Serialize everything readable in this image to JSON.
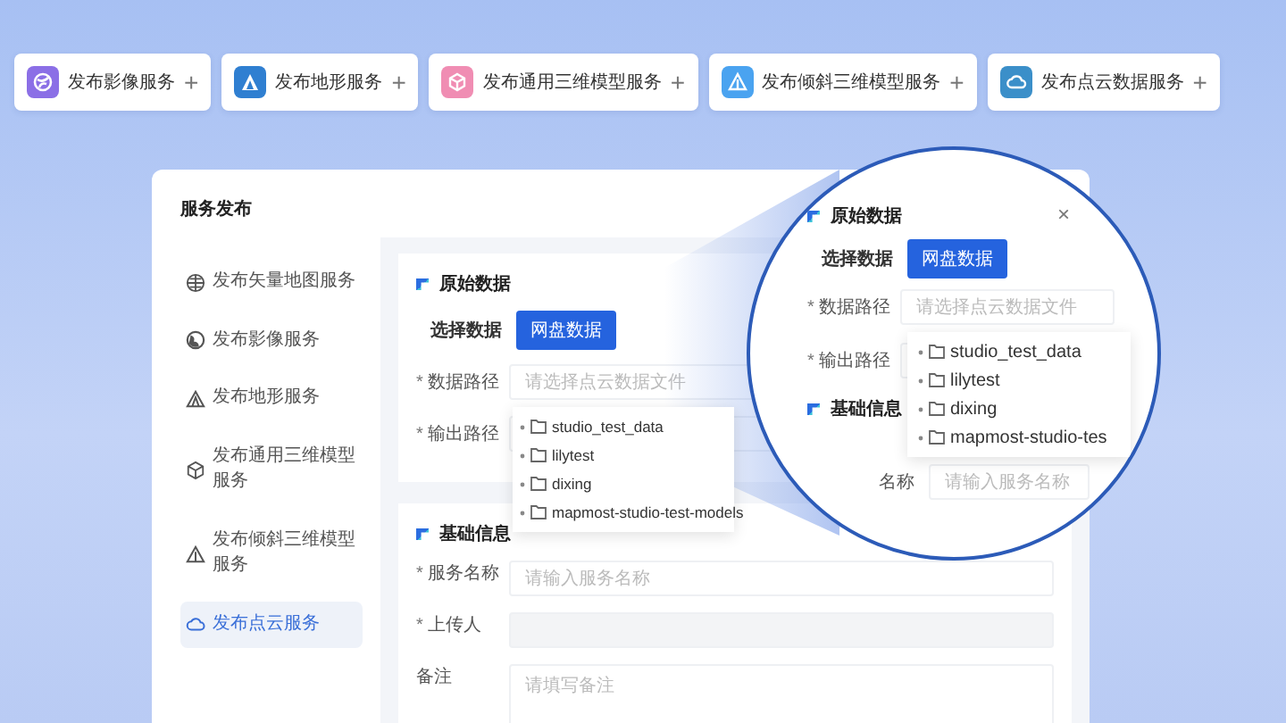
{
  "service_cards": [
    {
      "label": "发布影像服务",
      "plus": "+",
      "kind": "globe",
      "color": "#8b6fe6"
    },
    {
      "label": "发布地形服务",
      "plus": "+",
      "kind": "terrain",
      "color": "#2f7fd1"
    },
    {
      "label": "发布通用三维模型服务",
      "plus": "+",
      "kind": "cube",
      "color": "#f08db3"
    },
    {
      "label": "发布倾斜三维模型服务",
      "plus": "+",
      "kind": "tilt",
      "color": "#4aa3f0"
    },
    {
      "label": "发布点云数据服务",
      "plus": "+",
      "kind": "cloud",
      "color": "#3b8fc9"
    }
  ],
  "dialog": {
    "title": "服务发布"
  },
  "sidebar": {
    "items": [
      {
        "label": "发布矢量地图服务",
        "kind": "globe",
        "selected": false
      },
      {
        "label": "发布影像服务",
        "kind": "earth",
        "selected": false
      },
      {
        "label": "发布地形服务",
        "kind": "terrain",
        "selected": false
      },
      {
        "label": "发布通用三维模型服务",
        "kind": "cube",
        "selected": false
      },
      {
        "label": "发布倾斜三维模型服务",
        "kind": "tilt",
        "selected": false
      },
      {
        "label": "发布点云服务",
        "kind": "cloud",
        "selected": true
      }
    ]
  },
  "source_section": {
    "title": "原始数据",
    "tabs": [
      {
        "label": "选择数据",
        "selected": false
      },
      {
        "label": "网盘数据",
        "selected": true
      }
    ],
    "fields": [
      {
        "mark": "*",
        "label": "数据路径",
        "placeholder": "请选择点云数据文件"
      },
      {
        "mark": "*",
        "label": "输出路径"
      }
    ],
    "tree": [
      {
        "name": "studio_test_data"
      },
      {
        "name": "lilytest"
      },
      {
        "name": "dixing"
      },
      {
        "name": "mapmost-studio-test-models"
      }
    ]
  },
  "basic_section": {
    "title": "基础信息",
    "fields": [
      {
        "mark": "*",
        "label": "服务名称",
        "placeholder": "请输入服务名称",
        "kind": "input"
      },
      {
        "mark": "*",
        "label": "上传人",
        "kind": "readonly"
      },
      {
        "label": "备注",
        "placeholder": "请填写备注",
        "kind": "textarea"
      }
    ]
  },
  "magnifier": {
    "close": "×",
    "title": "原始数据",
    "tabs": [
      {
        "label": "选择数据",
        "selected": false
      },
      {
        "label": "网盘数据",
        "selected": true
      }
    ],
    "fields": [
      {
        "mark": "*",
        "label": "数据路径",
        "placeholder": "请选择点云数据文件"
      },
      {
        "mark": "*",
        "label": "输出路径"
      }
    ],
    "tree": [
      {
        "name": "studio_test_data"
      },
      {
        "name": "lilytest"
      },
      {
        "name": "dixing"
      },
      {
        "name": "mapmost-studio-tes"
      }
    ],
    "next_title": "基础信息",
    "next_field": {
      "label": "名称",
      "placeholder": "请输入服务名称"
    }
  }
}
